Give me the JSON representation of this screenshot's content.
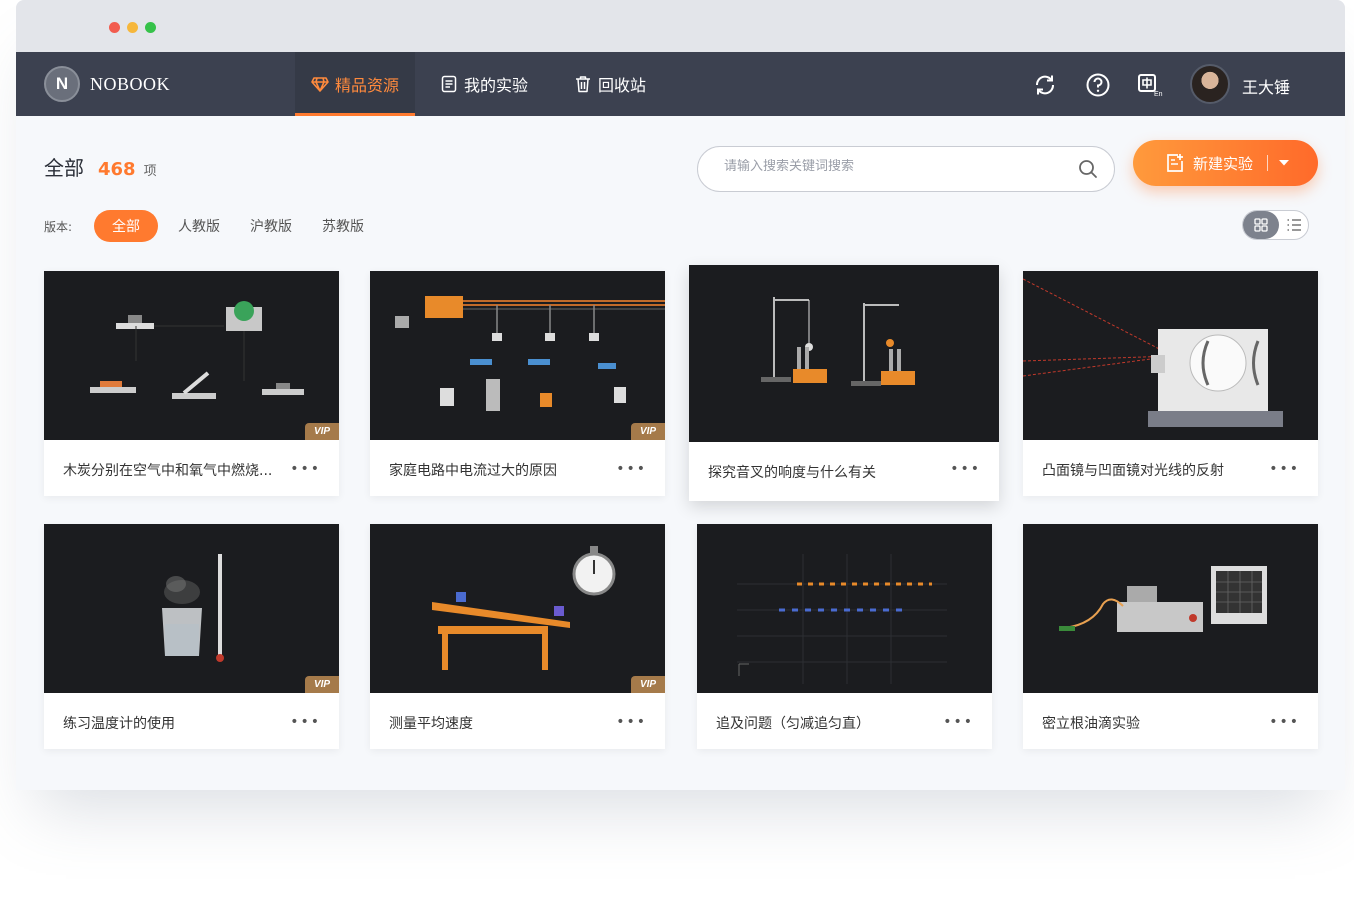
{
  "nav": {
    "logo_letter": "N",
    "logo_text": "NOBOOK",
    "tabs": [
      {
        "label": "精品资源",
        "icon": "diamond-icon",
        "active": true
      },
      {
        "label": "我的实验",
        "icon": "document-icon",
        "active": false
      },
      {
        "label": "回收站",
        "icon": "trash-icon",
        "active": false
      }
    ],
    "actions": [
      "sync-icon",
      "help-icon",
      "language-icon"
    ],
    "username": "王大锤"
  },
  "header": {
    "title": "全部",
    "count": "468",
    "unit": "项"
  },
  "search": {
    "placeholder": "请输入搜索关键词搜索"
  },
  "new_button": {
    "label": "新建实验"
  },
  "filter": {
    "label": "版本:",
    "options": [
      "全部",
      "人教版",
      "沪教版",
      "苏教版"
    ],
    "selected": "全部"
  },
  "colors": {
    "accent": "#ff7a2f",
    "nav_bg": "#3c4150",
    "vip": "#a57a4a"
  },
  "cards": [
    {
      "title": "木炭分别在空气中和氧气中燃烧...",
      "vip": "VIP"
    },
    {
      "title": "家庭电路中电流过大的原因",
      "vip": "VIP"
    },
    {
      "title": "探究音叉的响度与什么有关",
      "vip": ""
    },
    {
      "title": "凸面镜与凹面镜对光线的反射",
      "vip": ""
    },
    {
      "title": "练习温度计的使用",
      "vip": "VIP"
    },
    {
      "title": "测量平均速度",
      "vip": "VIP"
    },
    {
      "title": "追及问题（匀减追匀直）",
      "vip": ""
    },
    {
      "title": "密立根油滴实验",
      "vip": ""
    }
  ],
  "more_glyph": "•••"
}
